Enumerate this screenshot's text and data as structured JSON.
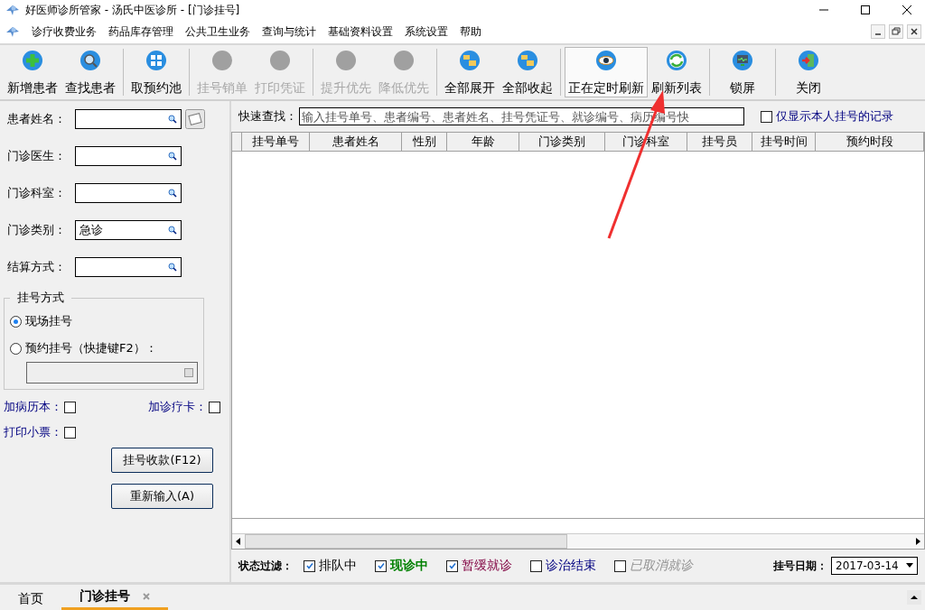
{
  "window": {
    "title": "好医师诊所管家 - 汤氏中医诊所 - [门诊挂号]"
  },
  "menu": [
    "诊疗收费业务",
    "药品库存管理",
    "公共卫生业务",
    "查询与统计",
    "基础资料设置",
    "系统设置",
    "帮助"
  ],
  "toolbar": [
    [
      {
        "label": "新增患者",
        "kind": "add",
        "disabled": false,
        "pressed": false
      },
      {
        "label": "查找患者",
        "kind": "search",
        "disabled": false,
        "pressed": false
      }
    ],
    [
      {
        "label": "取预约池",
        "kind": "grid",
        "disabled": false,
        "pressed": false
      }
    ],
    [
      {
        "label": "挂号销单",
        "kind": "blank",
        "disabled": true,
        "pressed": false
      },
      {
        "label": "打印凭证",
        "kind": "blank",
        "disabled": true,
        "pressed": false
      }
    ],
    [
      {
        "label": "提升优先",
        "kind": "blank",
        "disabled": true,
        "pressed": false
      },
      {
        "label": "降低优先",
        "kind": "blank",
        "disabled": true,
        "pressed": false
      }
    ],
    [
      {
        "label": "全部展开",
        "kind": "folders",
        "disabled": false,
        "pressed": false
      },
      {
        "label": "全部收起",
        "kind": "folders",
        "disabled": false,
        "pressed": false
      }
    ],
    [
      {
        "label": "正在定时刷新",
        "kind": "eye",
        "disabled": false,
        "pressed": true
      },
      {
        "label": "刷新列表",
        "kind": "refresh",
        "disabled": false,
        "pressed": false
      }
    ],
    [
      {
        "label": "锁屏",
        "kind": "monitor",
        "disabled": false,
        "pressed": false
      }
    ],
    [
      {
        "label": "关闭",
        "kind": "exit",
        "disabled": false,
        "pressed": false
      }
    ]
  ],
  "form": {
    "fields": [
      {
        "label": "患者姓名："
      },
      {
        "label": "门诊医生："
      },
      {
        "label": "门诊科室："
      },
      {
        "label": "门诊类别：",
        "value": "急诊"
      },
      {
        "label": "结算方式："
      }
    ],
    "registration_mode": {
      "title": "挂号方式",
      "options": [
        {
          "label": "现场挂号",
          "selected": true
        },
        {
          "label": "预约挂号（快捷键F2）：",
          "selected": false
        }
      ]
    },
    "extras": [
      {
        "label": "加病历本：",
        "checked": false
      },
      {
        "label": "加诊疗卡：",
        "checked": false
      },
      {
        "label": "打印小票：",
        "checked": false
      }
    ],
    "buttons": [
      "挂号收款(F12)",
      "重新输入(A)"
    ]
  },
  "quick_search": {
    "label": "快速查找：",
    "placeholder": "输入挂号单号、患者编号、患者姓名、挂号凭证号、就诊编号、病历编号快",
    "only_mine": {
      "label": "仅显示本人挂号的记录",
      "checked": false
    }
  },
  "table": {
    "columns": [
      "挂号单号",
      "患者姓名",
      "性别",
      "年龄",
      "门诊类别",
      "门诊科室",
      "挂号员",
      "挂号时间",
      "预约时段"
    ]
  },
  "filter": {
    "label": "状态过滤：",
    "items": [
      {
        "label": "排队中",
        "checked": true,
        "color": "#000000",
        "kind": "queued"
      },
      {
        "label": "现诊中",
        "checked": true,
        "color": "#008000",
        "kind": "active"
      },
      {
        "label": "暂缓就诊",
        "checked": true,
        "color": "#800040",
        "kind": "deferred"
      },
      {
        "label": "诊治结束",
        "checked": false,
        "color": "#000080",
        "kind": "finished"
      },
      {
        "label": "已取消就诊",
        "checked": false,
        "color": "#909090",
        "kind": "cancelled"
      }
    ],
    "date_label": "挂号日期：",
    "date": "2017-03-14"
  },
  "tabs": [
    {
      "label": "首页",
      "selected": false,
      "closable": false
    },
    {
      "label": "门诊挂号",
      "selected": true,
      "closable": true
    }
  ]
}
